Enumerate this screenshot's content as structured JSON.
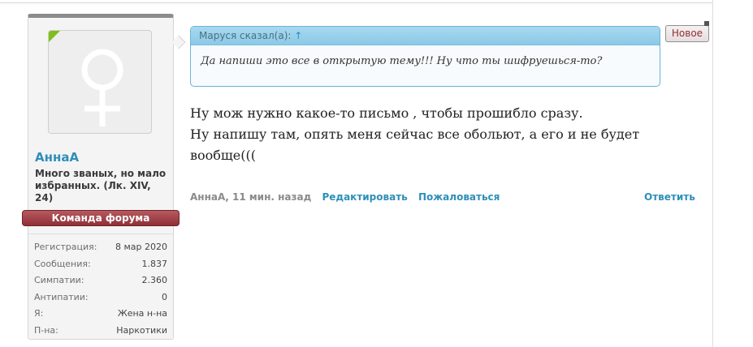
{
  "user": {
    "name": "АннаА",
    "title": "Много званых, но мало избранных. (Лк. XIV, 24)",
    "banner": "Команда форума",
    "stats": [
      {
        "label": "Регистрация:",
        "value": "8 мар 2020"
      },
      {
        "label": "Сообщения:",
        "value": "1.837"
      },
      {
        "label": "Симпатии:",
        "value": "2.360"
      },
      {
        "label": "Антипатии:",
        "value": "0"
      },
      {
        "label": "Я:",
        "value": "Жена н-на"
      },
      {
        "label": "П-на:",
        "value": "Наркотики"
      }
    ]
  },
  "quote": {
    "author": "Маруся сказал(а):",
    "arrow": "↑",
    "text": "Да напиши это все в открытую тему!!! Ну что ты шифруешься-то?"
  },
  "message": {
    "line1": "Ну мож нужно какое-то письмо , чтобы прошибло сразу.",
    "line2": "Ну напишу там, опять меня сейчас все обольют, а его и не будет",
    "line3": "вообще((("
  },
  "meta": {
    "author_time": "АннаА, 11 мин. назад",
    "edit": "Редактировать",
    "report": "Пожаловаться",
    "reply": "Ответить"
  },
  "badge": {
    "label": "Новое"
  },
  "icons": {
    "avatar": "female-symbol-icon"
  },
  "colors": {
    "accent": "#2e8fb8",
    "banner": "#8f3037",
    "quote_border": "#6ab4d8",
    "online": "#7fbf1a"
  }
}
